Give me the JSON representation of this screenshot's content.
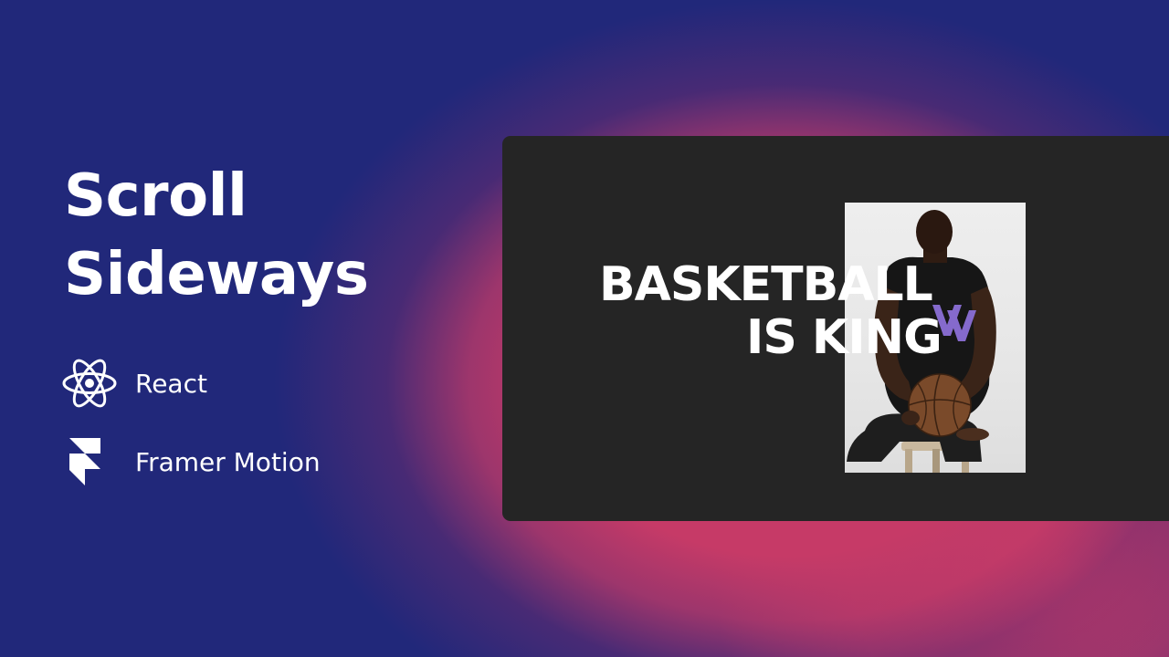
{
  "title": {
    "line1": "Scroll",
    "line2": "Sideways"
  },
  "tech": [
    {
      "label": "React",
      "icon": "react-icon"
    },
    {
      "label": "Framer Motion",
      "icon": "framer-icon"
    }
  ],
  "preview": {
    "headline_line1": "BASKETBALL",
    "headline_line2": "IS KING",
    "image": "basketball-player-photo"
  },
  "colors": {
    "background_blue": "#21287a",
    "background_pink": "#c63a67",
    "card": "#252525",
    "text": "#ffffff",
    "jersey_accent": "#8b6fd6"
  }
}
